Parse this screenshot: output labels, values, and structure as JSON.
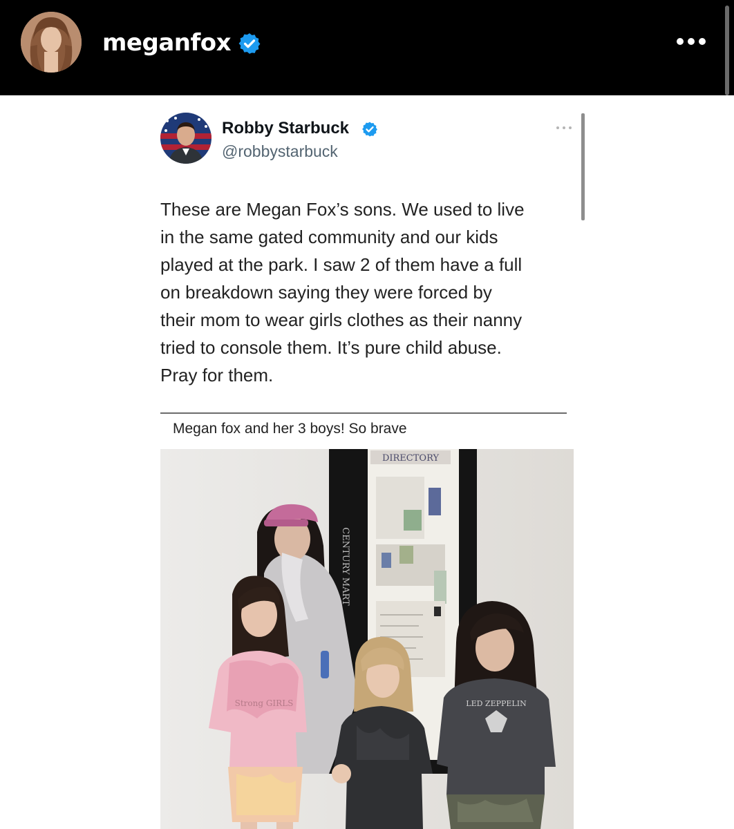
{
  "story": {
    "username": "meganfox",
    "verified": true,
    "more_icon": "more-horizontal-icon"
  },
  "tweet": {
    "author_name": "Robby Starbuck",
    "author_handle": "@robbystarbuck",
    "verified": true,
    "text": "These are Megan Fox’s sons. We used to live\nin the same gated community and our kids\nplayed at the park. I saw 2 of them have a full\non breakdown saying they were forced by\ntheir mom to wear girls clothes as their nanny\ntried to console them. It’s pure child abuse.\nPray for them.",
    "quoted_caption": "Megan fox and her 3 boys! So brave"
  },
  "photo": {
    "sign_directory": "DIRECTORY",
    "sign_vertical": "CENTURY MART",
    "shirt_left": "Strong GIRLS",
    "shirt_right": "LED ZEPPELIN"
  },
  "colors": {
    "verified_blue": "#1d9bf0",
    "header_bg": "#000000",
    "text_primary": "#0f1419",
    "text_secondary": "#536471"
  }
}
